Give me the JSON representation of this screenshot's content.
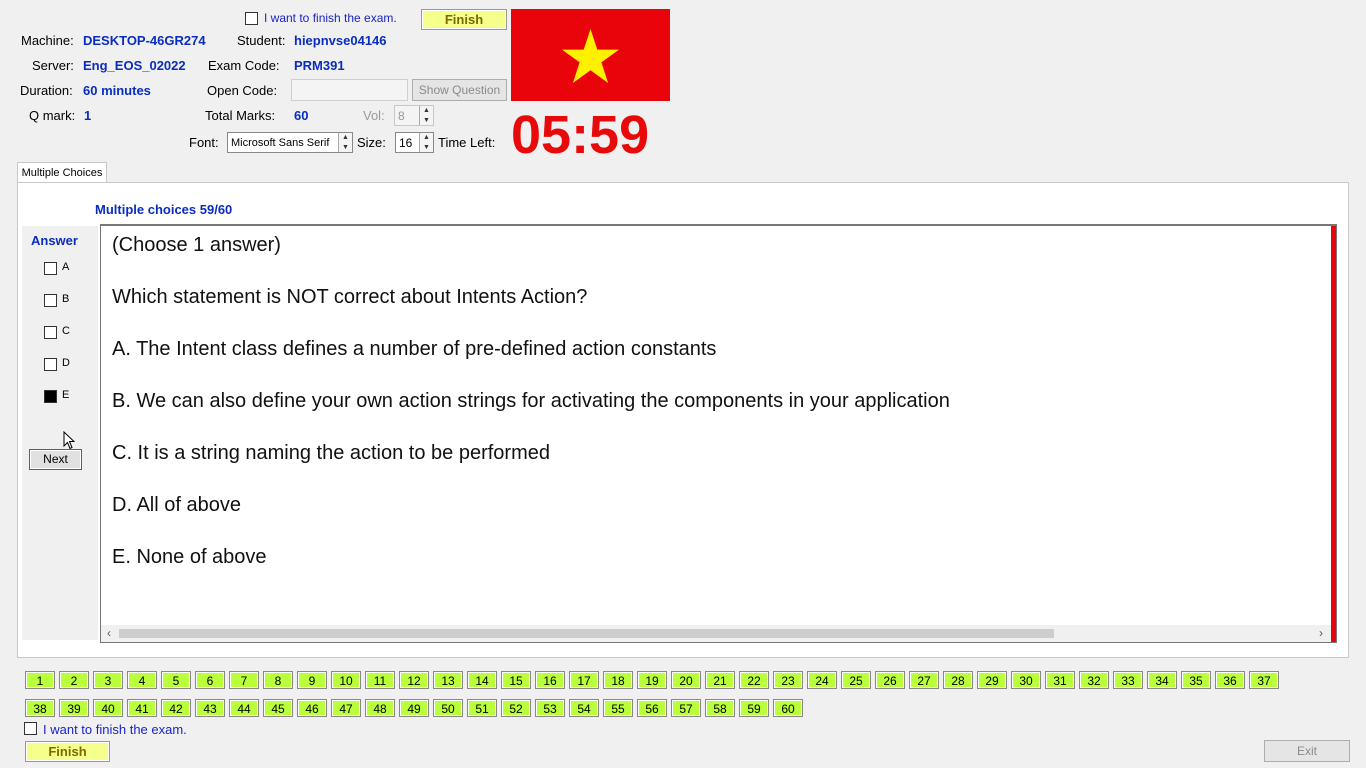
{
  "top": {
    "finish_check_label": "I want to finish the exam.",
    "finish_button": "Finish",
    "machine_label": "Machine:",
    "machine_value": "DESKTOP-46GR274",
    "student_label": "Student:",
    "student_value": "hiepnvse04146",
    "server_label": "Server:",
    "server_value": "Eng_EOS_02022",
    "exam_code_label": "Exam Code:",
    "exam_code_value": "PRM391",
    "duration_label": "Duration:",
    "duration_value": "60 minutes",
    "open_code_label": "Open Code:",
    "open_code_value": "",
    "show_question_button": "Show Question",
    "qmark_label": "Q mark:",
    "qmark_value": "1",
    "total_marks_label": "Total Marks:",
    "total_marks_value": "60",
    "vol_label": "Vol:",
    "vol_value": "8",
    "font_label": "Font:",
    "font_value": "Microsoft Sans Serif",
    "size_label": "Size:",
    "size_value": "16",
    "time_left_label": "Time Left:",
    "time_left_value": "05:59"
  },
  "tab": {
    "label": "Multiple Choices"
  },
  "question": {
    "heading": "Multiple choices 59/60",
    "answer_label": "Answer",
    "options": [
      {
        "label": "A",
        "checked": false
      },
      {
        "label": "B",
        "checked": false
      },
      {
        "label": "C",
        "checked": false
      },
      {
        "label": "D",
        "checked": false
      },
      {
        "label": "E",
        "checked": true
      }
    ],
    "next_button": "Next",
    "lines": [
      "(Choose 1 answer)",
      "Which statement is NOT correct about Intents Action?",
      "A.  The Intent class defines a number of pre-defined action constants",
      "B.  We can also define your own action strings for activating the components in your application",
      "C.  It is a string naming the action to be performed",
      "D.  All of above",
      "E.  None of above"
    ]
  },
  "nav": {
    "row1": [
      "1",
      "2",
      "3",
      "4",
      "5",
      "6",
      "7",
      "8",
      "9",
      "10",
      "11",
      "12",
      "13",
      "14",
      "15",
      "16",
      "17",
      "18",
      "19",
      "20",
      "21",
      "22",
      "23",
      "24",
      "25",
      "26",
      "27",
      "28",
      "29",
      "30",
      "31",
      "32",
      "33",
      "34",
      "35",
      "36",
      "37"
    ],
    "row2": [
      "38",
      "39",
      "40",
      "41",
      "42",
      "43",
      "44",
      "45",
      "46",
      "47",
      "48",
      "49",
      "50",
      "51",
      "52",
      "53",
      "54",
      "55",
      "56",
      "57",
      "58",
      "59",
      "60"
    ]
  },
  "bottom": {
    "finish_check_label": "I want to finish the exam.",
    "finish_button": "Finish",
    "exit_button": "Exit"
  },
  "colors": {
    "value_blue": "#0a2dbf",
    "timer_red": "#e80a0a",
    "flag_red": "#e8040a",
    "flag_star": "#ffef00",
    "nav_green": "#b9ff3c",
    "finish_yellow": "#f4ff8c"
  }
}
